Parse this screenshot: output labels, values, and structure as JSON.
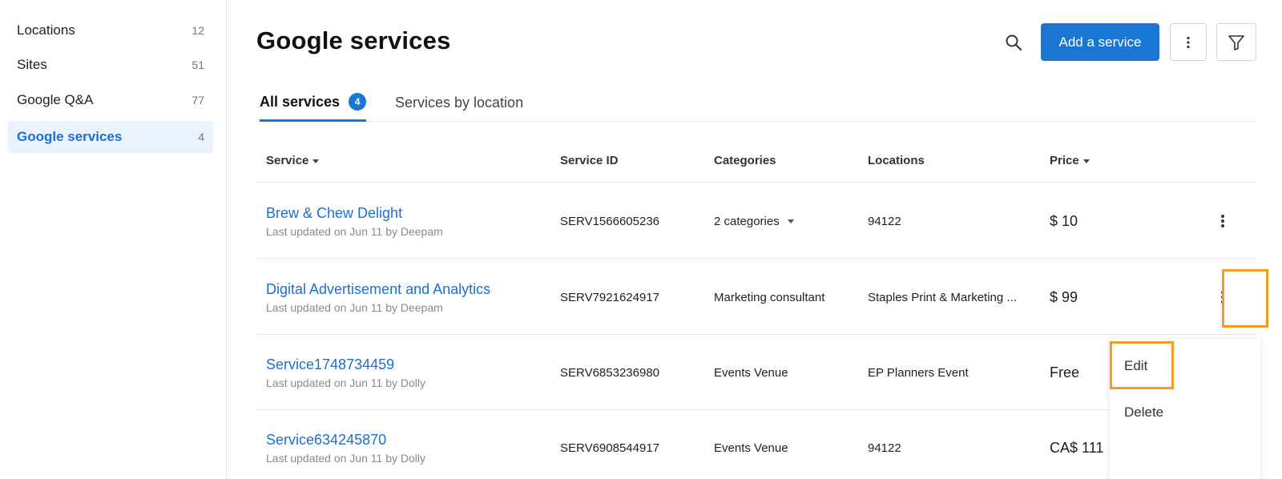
{
  "sidebar": {
    "items": [
      {
        "label": "Locations",
        "count": "12"
      },
      {
        "label": "Sites",
        "count": "51"
      },
      {
        "label": "Google Q&A",
        "count": "77"
      },
      {
        "label": "Google services",
        "count": "4"
      }
    ]
  },
  "header": {
    "title": "Google services",
    "add_button": "Add a service"
  },
  "tabs": [
    {
      "label": "All services",
      "badge": "4"
    },
    {
      "label": "Services by location"
    }
  ],
  "table": {
    "columns": [
      "Service",
      "Service ID",
      "Categories",
      "Locations",
      "Price"
    ],
    "rows": [
      {
        "name": "Brew & Chew Delight",
        "meta": "Last updated on Jun 11 by Deepam",
        "id": "SERV1566605236",
        "categories": "2 categories",
        "locations": "94122",
        "price": "$ 10"
      },
      {
        "name": "Digital Advertisement and Analytics",
        "meta": "Last updated on Jun 11 by Deepam",
        "id": "SERV7921624917",
        "categories": "Marketing consultant",
        "locations": "Staples Print & Marketing ...",
        "price": "$ 99"
      },
      {
        "name": "Service1748734459",
        "meta": "Last updated on Jun 11 by Dolly",
        "id": "SERV6853236980",
        "categories": "Events Venue",
        "locations": "EP Planners Event",
        "price": "Free"
      },
      {
        "name": "Service634245870",
        "meta": "Last updated on Jun 11 by Dolly",
        "id": "SERV6908544917",
        "categories": "Events Venue",
        "locations": "94122",
        "price": "CA$ 111"
      }
    ]
  },
  "row_menu": {
    "edit": "Edit",
    "delete": "Delete"
  },
  "icons": {
    "search": "search-icon",
    "more": "more-vertical-icon",
    "filter": "filter-icon"
  },
  "colors": {
    "accent": "#1976d2",
    "link": "#1c6fd1",
    "highlight": "#f59a23",
    "active_bg": "#e9f2fe"
  }
}
